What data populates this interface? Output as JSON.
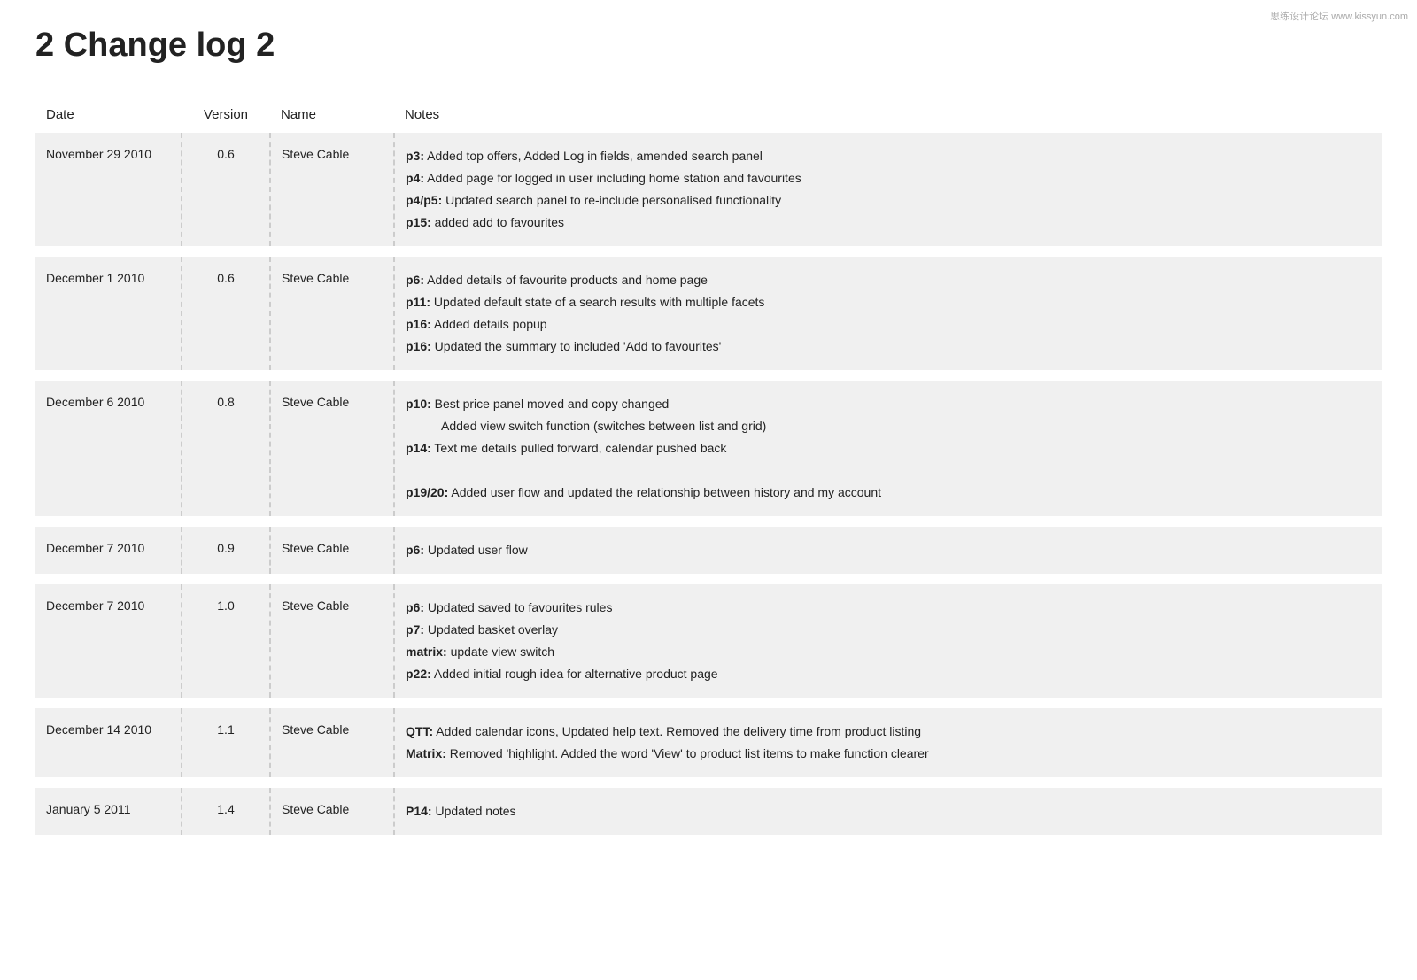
{
  "watermark": "思练设计论坛 www.kissyun.com",
  "title": "2 Change log 2",
  "table": {
    "headers": {
      "date": "Date",
      "version": "Version",
      "name": "Name",
      "notes": "Notes"
    },
    "rows": [
      {
        "date": "November 29 2010",
        "version": "0.6",
        "name": "Steve Cable",
        "notes_html": "<p><b>p3:</b> Added top offers, Added Log in fields, amended search panel</p><p><b>p4:</b> Added page for logged in user including home station and favourites</p><p><b>p4/p5:</b> Updated search panel to re-include personalised functionality</p><p><b>p15:</b> added add to favourites</p>"
      },
      {
        "date": "December 1 2010",
        "version": "0.6",
        "name": "Steve Cable",
        "notes_html": "<p><b>p6:</b> Added details of favourite products and home page</p><p><b>p11:</b> Updated default state of a search results with multiple facets</p><p><b>p16:</b> Added details popup</p><p><b>p16:</b> Updated the summary to included 'Add to favourites'</p>"
      },
      {
        "date": "December 6 2010",
        "version": "0.8",
        "name": "Steve Cable",
        "notes_html": "<p><b>p10:</b> Best price panel moved and copy changed</p><p style='padding-left:40px;'>Added view switch function (switches between list and grid)</p><p><b>p14:</b> Text me details pulled forward, calendar pushed back</p><p>&nbsp;</p><p><b>p19/20:</b> Added user flow and updated the relationship between history and my account</p>"
      },
      {
        "date": "December 7 2010",
        "version": "0.9",
        "name": "Steve Cable",
        "notes_html": "<p><b>p6:</b> Updated user flow</p>"
      },
      {
        "date": "December 7 2010",
        "version": "1.0",
        "name": "Steve Cable",
        "notes_html": "<p><b>p6:</b> Updated saved to favourites rules</p><p><b>p7:</b> Updated basket overlay</p><p><b>matrix:</b> update view switch</p><p><b>p22:</b> Added initial rough idea for alternative product page</p>"
      },
      {
        "date": "December 14 2010",
        "version": "1.1",
        "name": "Steve Cable",
        "notes_html": "<p><b>QTT:</b> Added calendar icons,  Updated help text. Removed the delivery time from product listing</p><p><b>Matrix:</b> Removed 'highlight. Added the word 'View' to product list items to make function clearer</p>"
      },
      {
        "date": "January 5 2011",
        "version": "1.4",
        "name": "Steve Cable",
        "notes_html": "<p><b>P14:</b> Updated notes</p>"
      }
    ]
  }
}
